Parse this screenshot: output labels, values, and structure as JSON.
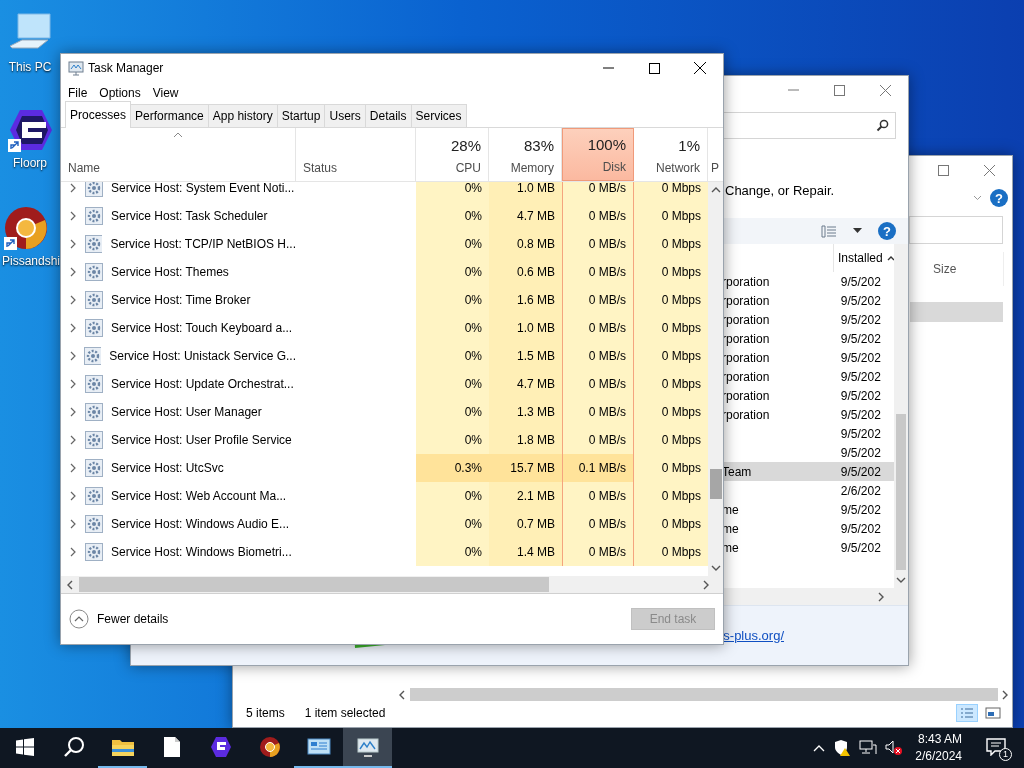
{
  "desktop_icons": [
    {
      "label": "This PC",
      "kind": "pc",
      "shortcut": false
    },
    {
      "label": "Floorp",
      "kind": "floorp",
      "shortcut": true
    },
    {
      "label": "Pissandshi",
      "kind": "browser",
      "shortcut": true
    }
  ],
  "explorer_window": {
    "help": "?",
    "column": "Size",
    "status": [
      "5 items",
      "1 item selected"
    ]
  },
  "programs_window": {
    "instruction": "Change, or Repair.",
    "help": "?",
    "column": "Installed",
    "rows": [
      {
        "publisher": "rporation",
        "installed": "9/5/202",
        "selected": false
      },
      {
        "publisher": "rporation",
        "installed": "9/5/202",
        "selected": false
      },
      {
        "publisher": "rporation",
        "installed": "9/5/202",
        "selected": false
      },
      {
        "publisher": "rporation",
        "installed": "9/5/202",
        "selected": false
      },
      {
        "publisher": "rporation",
        "installed": "9/5/202",
        "selected": false
      },
      {
        "publisher": "rporation",
        "installed": "9/5/202",
        "selected": false
      },
      {
        "publisher": "rporation",
        "installed": "9/5/202",
        "selected": false
      },
      {
        "publisher": "rporation",
        "installed": "9/5/202",
        "selected": false
      },
      {
        "publisher": "",
        "installed": "9/5/202",
        "selected": false
      },
      {
        "publisher": "",
        "installed": "9/5/202",
        "selected": false
      },
      {
        "publisher": "Team",
        "installed": "9/5/202",
        "selected": true
      },
      {
        "publisher": "",
        "installed": "2/6/202",
        "selected": false
      },
      {
        "publisher": "me",
        "installed": "9/5/202",
        "selected": false
      },
      {
        "publisher": "me",
        "installed": "9/5/202",
        "selected": false
      },
      {
        "publisher": "me",
        "installed": "9/5/202",
        "selected": false
      }
    ],
    "link": "s-plus.org/"
  },
  "task_manager": {
    "title": "Task Manager",
    "menu": [
      "File",
      "Options",
      "View"
    ],
    "tabs": [
      {
        "label": "Processes",
        "selected": true
      },
      {
        "label": "Performance",
        "selected": false
      },
      {
        "label": "App history",
        "selected": false
      },
      {
        "label": "Startup",
        "selected": false
      },
      {
        "label": "Users",
        "selected": false
      },
      {
        "label": "Details",
        "selected": false
      },
      {
        "label": "Services",
        "selected": false
      }
    ],
    "columns": [
      {
        "kind": "name",
        "label": "Name"
      },
      {
        "kind": "status",
        "label": "Status"
      },
      {
        "kind": "metric",
        "percent": "28%",
        "label": "CPU",
        "alert": false
      },
      {
        "kind": "metric",
        "percent": "83%",
        "label": "Memory",
        "alert": false
      },
      {
        "kind": "metric",
        "percent": "100%",
        "label": "Disk",
        "alert": true
      },
      {
        "kind": "metric",
        "percent": "1%",
        "label": "Network",
        "alert": false
      },
      {
        "kind": "cut",
        "label": "P"
      }
    ],
    "rows": [
      {
        "name": "Service Host: System Event Noti...",
        "cpu": "0%",
        "memory": "1.0 MB",
        "disk": "0 MB/s",
        "network": "0 Mbps",
        "active": false
      },
      {
        "name": "Service Host: Task Scheduler",
        "cpu": "0%",
        "memory": "4.7 MB",
        "disk": "0 MB/s",
        "network": "0 Mbps",
        "active": false
      },
      {
        "name": "Service Host: TCP/IP NetBIOS H...",
        "cpu": "0%",
        "memory": "0.8 MB",
        "disk": "0 MB/s",
        "network": "0 Mbps",
        "active": false
      },
      {
        "name": "Service Host: Themes",
        "cpu": "0%",
        "memory": "0.6 MB",
        "disk": "0 MB/s",
        "network": "0 Mbps",
        "active": false
      },
      {
        "name": "Service Host: Time Broker",
        "cpu": "0%",
        "memory": "1.6 MB",
        "disk": "0 MB/s",
        "network": "0 Mbps",
        "active": false
      },
      {
        "name": "Service Host: Touch Keyboard a...",
        "cpu": "0%",
        "memory": "1.0 MB",
        "disk": "0 MB/s",
        "network": "0 Mbps",
        "active": false
      },
      {
        "name": "Service Host: Unistack Service G...",
        "cpu": "0%",
        "memory": "1.5 MB",
        "disk": "0 MB/s",
        "network": "0 Mbps",
        "active": false
      },
      {
        "name": "Service Host: Update Orchestrat...",
        "cpu": "0%",
        "memory": "4.7 MB",
        "disk": "0 MB/s",
        "network": "0 Mbps",
        "active": false
      },
      {
        "name": "Service Host: User Manager",
        "cpu": "0%",
        "memory": "1.3 MB",
        "disk": "0 MB/s",
        "network": "0 Mbps",
        "active": false
      },
      {
        "name": "Service Host: User Profile Service",
        "cpu": "0%",
        "memory": "1.8 MB",
        "disk": "0 MB/s",
        "network": "0 Mbps",
        "active": false
      },
      {
        "name": "Service Host: UtcSvc",
        "cpu": "0.3%",
        "memory": "15.7 MB",
        "disk": "0.1 MB/s",
        "network": "0 Mbps",
        "active": true
      },
      {
        "name": "Service Host: Web Account Ma...",
        "cpu": "0%",
        "memory": "2.1 MB",
        "disk": "0 MB/s",
        "network": "0 Mbps",
        "active": false
      },
      {
        "name": "Service Host: Windows Audio E...",
        "cpu": "0%",
        "memory": "0.7 MB",
        "disk": "0 MB/s",
        "network": "0 Mbps",
        "active": false
      },
      {
        "name": "Service Host: Windows Biometri...",
        "cpu": "0%",
        "memory": "1.4 MB",
        "disk": "0 MB/s",
        "network": "0 Mbps",
        "active": false
      }
    ],
    "fewer_details": "Fewer details",
    "end_task": {
      "label": "End task",
      "disabled": true
    }
  },
  "taskbar": {
    "apps": [
      {
        "kind": "explorer",
        "open": true,
        "active": false
      },
      {
        "kind": "notepad",
        "open": false,
        "active": false
      },
      {
        "kind": "floorp",
        "open": false,
        "active": false
      },
      {
        "kind": "browser",
        "open": false,
        "active": false
      },
      {
        "kind": "control-panel",
        "open": true,
        "active": false
      },
      {
        "kind": "task-manager",
        "open": true,
        "active": true
      }
    ],
    "time": "8:43 AM",
    "date": "2/6/2024",
    "notifications": "1"
  }
}
